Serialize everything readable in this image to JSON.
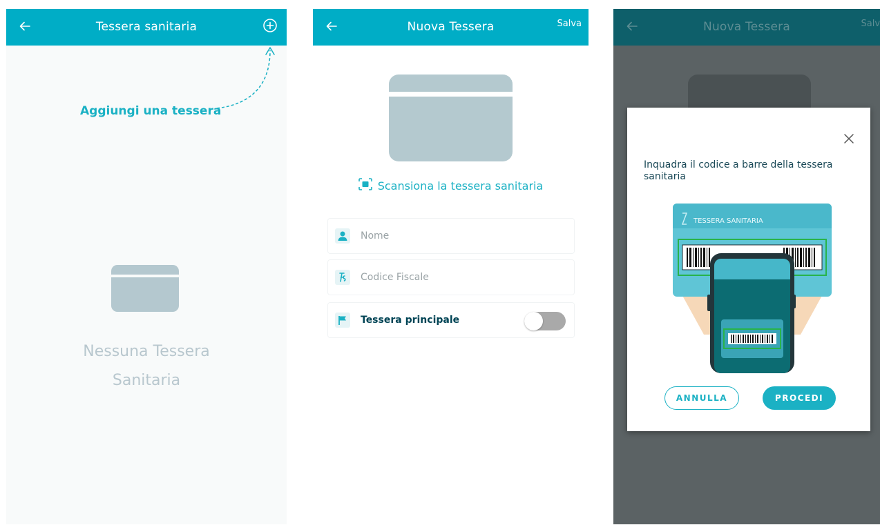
{
  "screen1": {
    "title": "Tessera sanitaria",
    "annotation": "Aggiungi una tessera",
    "empty_line1": "Nessuna Tessera",
    "empty_line2": "Sanitaria"
  },
  "screen2": {
    "title": "Nuova Tessera",
    "save_label": "Salva",
    "scan_label": "Scansiona la tessera sanitaria",
    "name_placeholder": "Nome",
    "fiscal_code_placeholder": "Codice Fiscale",
    "main_card_label": "Tessera principale",
    "main_card_toggle_on": false
  },
  "screen3": {
    "title": "Nuova Tessera",
    "save_label": "Salva",
    "dialog_message": "Inquadra il codice a barre della tessera sanitaria",
    "card_label": "TESSERA SANITARIA",
    "cancel_label": "ANNULLA",
    "proceed_label": "PROCEDI"
  },
  "colors": {
    "accent": "#00adc6",
    "teal_text": "#1bb1c4",
    "card_placeholder": "#b4c8cf",
    "dark_text": "#004455"
  },
  "icons": [
    "back-arrow-icon",
    "add-circle-icon",
    "scan-icon",
    "person-icon",
    "fiscal-code-icon",
    "flag-icon",
    "close-icon"
  ]
}
